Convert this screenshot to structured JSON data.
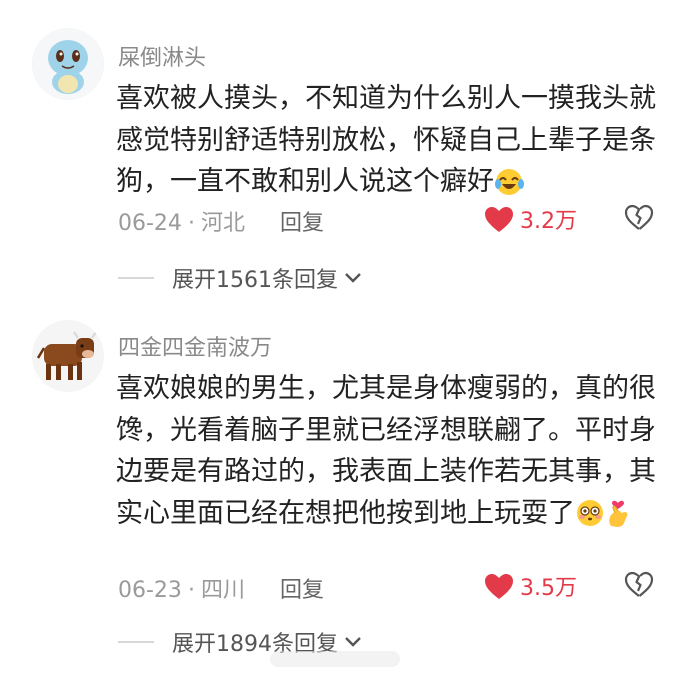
{
  "comments": [
    {
      "username": "屎倒淋头",
      "text": "喜欢被人摸头，不知道为什么别人一摸我头就感觉特别舒适特别放松，怀疑自己上辈子是条狗，一直不敢和别人说这个癖好",
      "date": "06-24",
      "location": "河北",
      "reply_label": "回复",
      "likes": "3.2万",
      "expand_label": "展开1561条回复",
      "avatar_icon": "squirtle-avatar",
      "emojis": [
        "laugh-cry-emoji"
      ]
    },
    {
      "username": "四金四金南波万",
      "text": "喜欢娘娘的男生，尤其是身体瘦弱的，真的很馋，光看着脑子里就已经浮想联翩了。平时身边要是有路过的，我表面上装作若无其事，其实心里面已经在想把他按到地上玩耍了",
      "date": "06-23",
      "location": "四川",
      "reply_label": "回复",
      "likes": "3.5万",
      "expand_label": "展开1894条回复",
      "avatar_icon": "cow-avatar",
      "emojis": [
        "flushed-face-emoji",
        "finger-heart-emoji"
      ]
    }
  ],
  "colors": {
    "like": "#e33a4a",
    "meta": "#9a9a9a",
    "username": "#8a8a8a",
    "text": "#222222"
  },
  "separator": "·"
}
